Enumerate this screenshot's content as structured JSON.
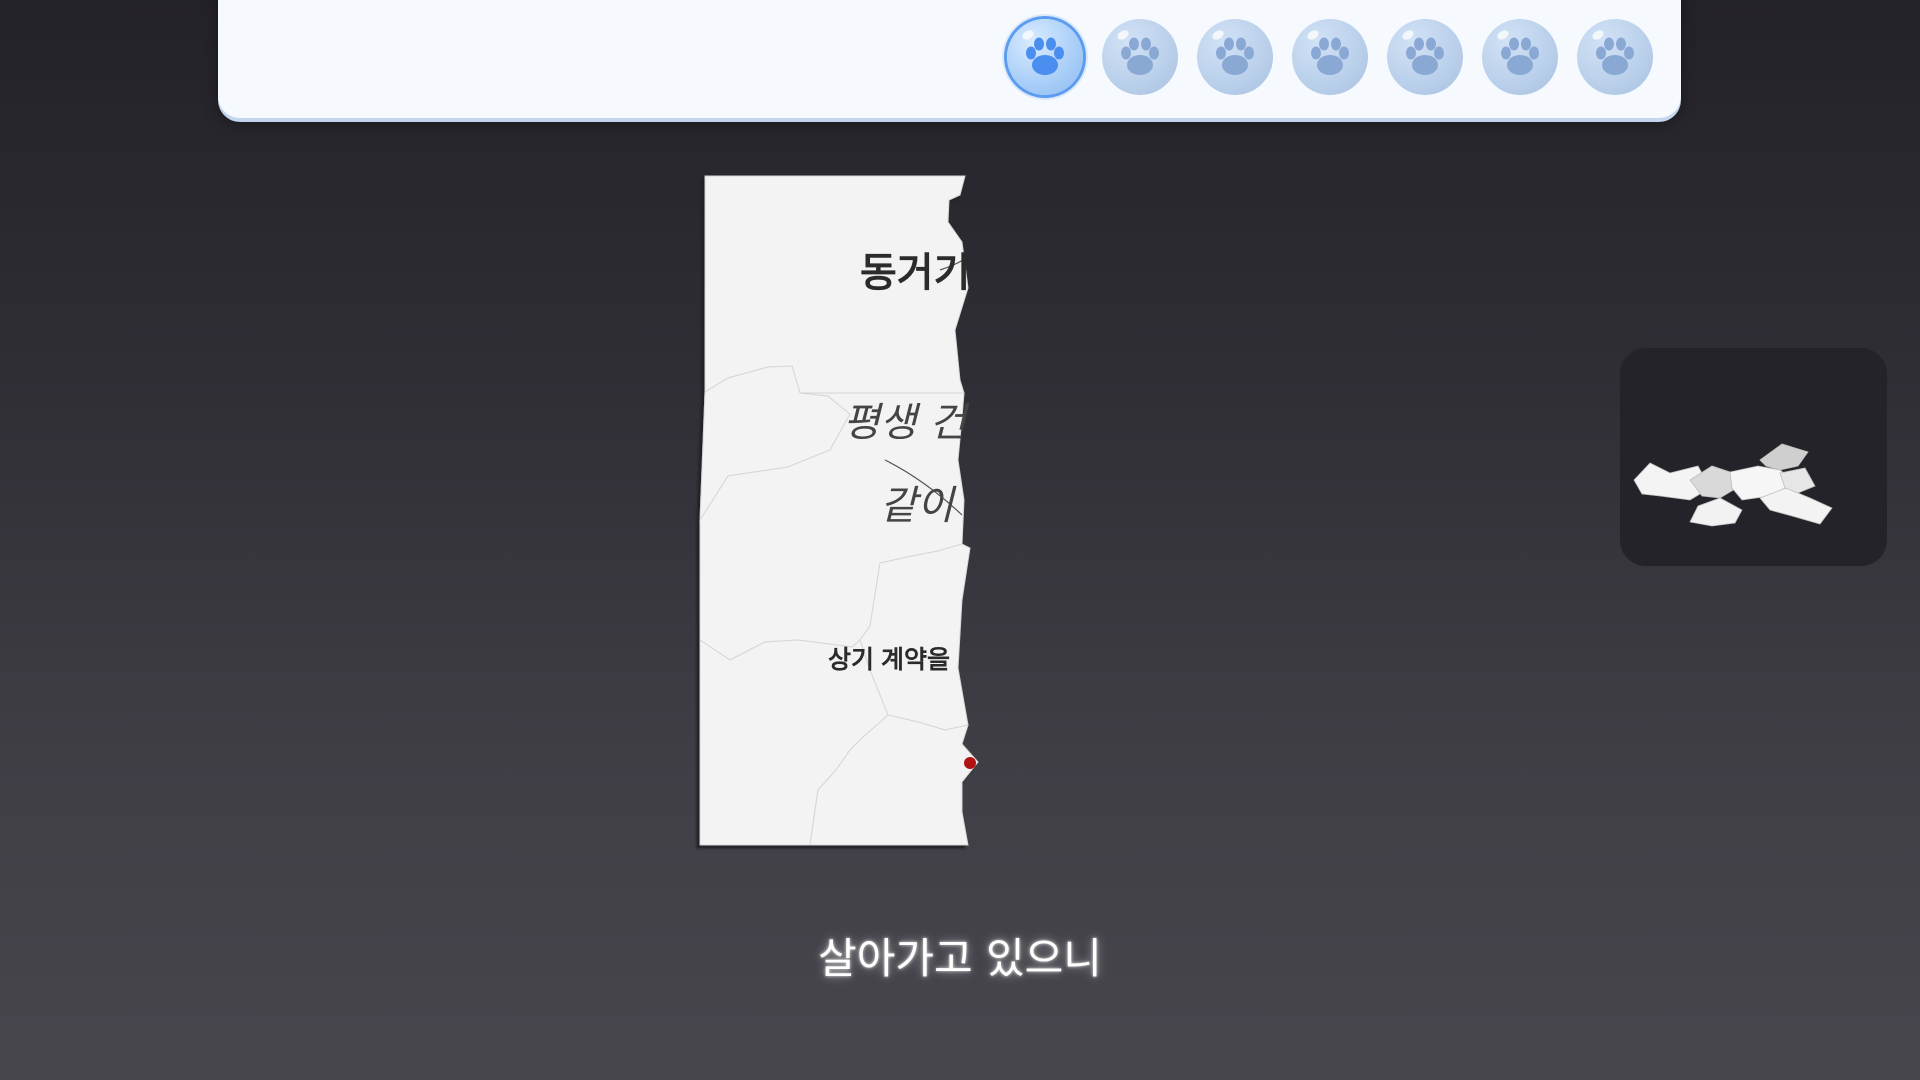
{
  "progress": {
    "total_slots": 7,
    "current_slot": 1,
    "slot_icon": "paw-icon",
    "colors": {
      "active": "#4a8ef0",
      "inactive": "#8aa8d4"
    }
  },
  "paper": {
    "title": "동거기",
    "line1": "평생 건",
    "line2": "같이",
    "line3": "상기 계약을"
  },
  "thumbnail": {
    "icon": "torn-paper-pieces"
  },
  "subtitle": "살아가고 있으니"
}
